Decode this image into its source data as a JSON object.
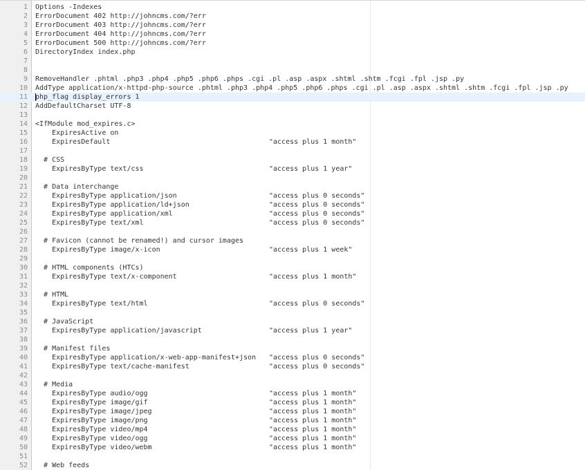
{
  "editor": {
    "current_line": 11,
    "lines": [
      {
        "n": "1",
        "code": "Options -Indexes",
        "val": ""
      },
      {
        "n": "2",
        "code": "ErrorDocument 402 http://johncms.com/?err",
        "val": ""
      },
      {
        "n": "3",
        "code": "ErrorDocument 403 http://johncms.com/?err",
        "val": ""
      },
      {
        "n": "4",
        "code": "ErrorDocument 404 http://johncms.com/?err",
        "val": ""
      },
      {
        "n": "5",
        "code": "ErrorDocument 500 http://johncms.com/?err",
        "val": ""
      },
      {
        "n": "6",
        "code": "DirectoryIndex index.php",
        "val": ""
      },
      {
        "n": "7",
        "code": "",
        "val": ""
      },
      {
        "n": "8",
        "code": "",
        "val": ""
      },
      {
        "n": "9",
        "code": "RemoveHandler .phtml .php3 .php4 .php5 .php6 .phps .cgi .pl .asp .aspx .shtml .shtm .fcgi .fpl .jsp .py",
        "val": ""
      },
      {
        "n": "10",
        "code": "AddType application/x-httpd-php-source .phtml .php3 .php4 .php5 .php6 .phps .cgi .pl .asp .aspx .shtml .shtm .fcgi .fpl .jsp .py",
        "val": ""
      },
      {
        "n": "11",
        "code": "php_flag display_errors 1",
        "val": ""
      },
      {
        "n": "12",
        "code": "AddDefaultCharset UTF-8",
        "val": ""
      },
      {
        "n": "13",
        "code": "",
        "val": ""
      },
      {
        "n": "14",
        "code": "<IfModule mod_expires.c>",
        "val": ""
      },
      {
        "n": "15",
        "code": "    ExpiresActive on",
        "val": ""
      },
      {
        "n": "16",
        "code": "    ExpiresDefault",
        "val": "\"access plus 1 month\""
      },
      {
        "n": "17",
        "code": "",
        "val": ""
      },
      {
        "n": "18",
        "code": "  # CSS",
        "val": ""
      },
      {
        "n": "19",
        "code": "    ExpiresByType text/css",
        "val": "\"access plus 1 year\""
      },
      {
        "n": "20",
        "code": "",
        "val": ""
      },
      {
        "n": "21",
        "code": "  # Data interchange",
        "val": ""
      },
      {
        "n": "22",
        "code": "    ExpiresByType application/json",
        "val": "\"access plus 0 seconds\""
      },
      {
        "n": "23",
        "code": "    ExpiresByType application/ld+json",
        "val": "\"access plus 0 seconds\""
      },
      {
        "n": "24",
        "code": "    ExpiresByType application/xml",
        "val": "\"access plus 0 seconds\""
      },
      {
        "n": "25",
        "code": "    ExpiresByType text/xml",
        "val": "\"access plus 0 seconds\""
      },
      {
        "n": "26",
        "code": "",
        "val": ""
      },
      {
        "n": "27",
        "code": "  # Favicon (cannot be renamed!) and cursor images",
        "val": ""
      },
      {
        "n": "28",
        "code": "    ExpiresByType image/x-icon",
        "val": "\"access plus 1 week\""
      },
      {
        "n": "29",
        "code": "",
        "val": ""
      },
      {
        "n": "30",
        "code": "  # HTML components (HTCs)",
        "val": ""
      },
      {
        "n": "31",
        "code": "    ExpiresByType text/x-component",
        "val": "\"access plus 1 month\""
      },
      {
        "n": "32",
        "code": "",
        "val": ""
      },
      {
        "n": "33",
        "code": "  # HTML",
        "val": ""
      },
      {
        "n": "34",
        "code": "    ExpiresByType text/html",
        "val": "\"access plus 0 seconds\""
      },
      {
        "n": "35",
        "code": "",
        "val": ""
      },
      {
        "n": "36",
        "code": "  # JavaScript",
        "val": ""
      },
      {
        "n": "37",
        "code": "    ExpiresByType application/javascript",
        "val": "\"access plus 1 year\""
      },
      {
        "n": "38",
        "code": "",
        "val": ""
      },
      {
        "n": "39",
        "code": "  # Manifest files",
        "val": ""
      },
      {
        "n": "40",
        "code": "    ExpiresByType application/x-web-app-manifest+json",
        "val": "\"access plus 0 seconds\""
      },
      {
        "n": "41",
        "code": "    ExpiresByType text/cache-manifest",
        "val": "\"access plus 0 seconds\""
      },
      {
        "n": "42",
        "code": "",
        "val": ""
      },
      {
        "n": "43",
        "code": "  # Media",
        "val": ""
      },
      {
        "n": "44",
        "code": "    ExpiresByType audio/ogg",
        "val": "\"access plus 1 month\""
      },
      {
        "n": "45",
        "code": "    ExpiresByType image/gif",
        "val": "\"access plus 1 month\""
      },
      {
        "n": "46",
        "code": "    ExpiresByType image/jpeg",
        "val": "\"access plus 1 month\""
      },
      {
        "n": "47",
        "code": "    ExpiresByType image/png",
        "val": "\"access plus 1 month\""
      },
      {
        "n": "48",
        "code": "    ExpiresByType video/mp4",
        "val": "\"access plus 1 month\""
      },
      {
        "n": "49",
        "code": "    ExpiresByType video/ogg",
        "val": "\"access plus 1 month\""
      },
      {
        "n": "50",
        "code": "    ExpiresByType video/webm",
        "val": "\"access plus 1 month\""
      },
      {
        "n": "51",
        "code": "",
        "val": ""
      },
      {
        "n": "52",
        "code": "  # Web feeds",
        "val": ""
      }
    ]
  }
}
